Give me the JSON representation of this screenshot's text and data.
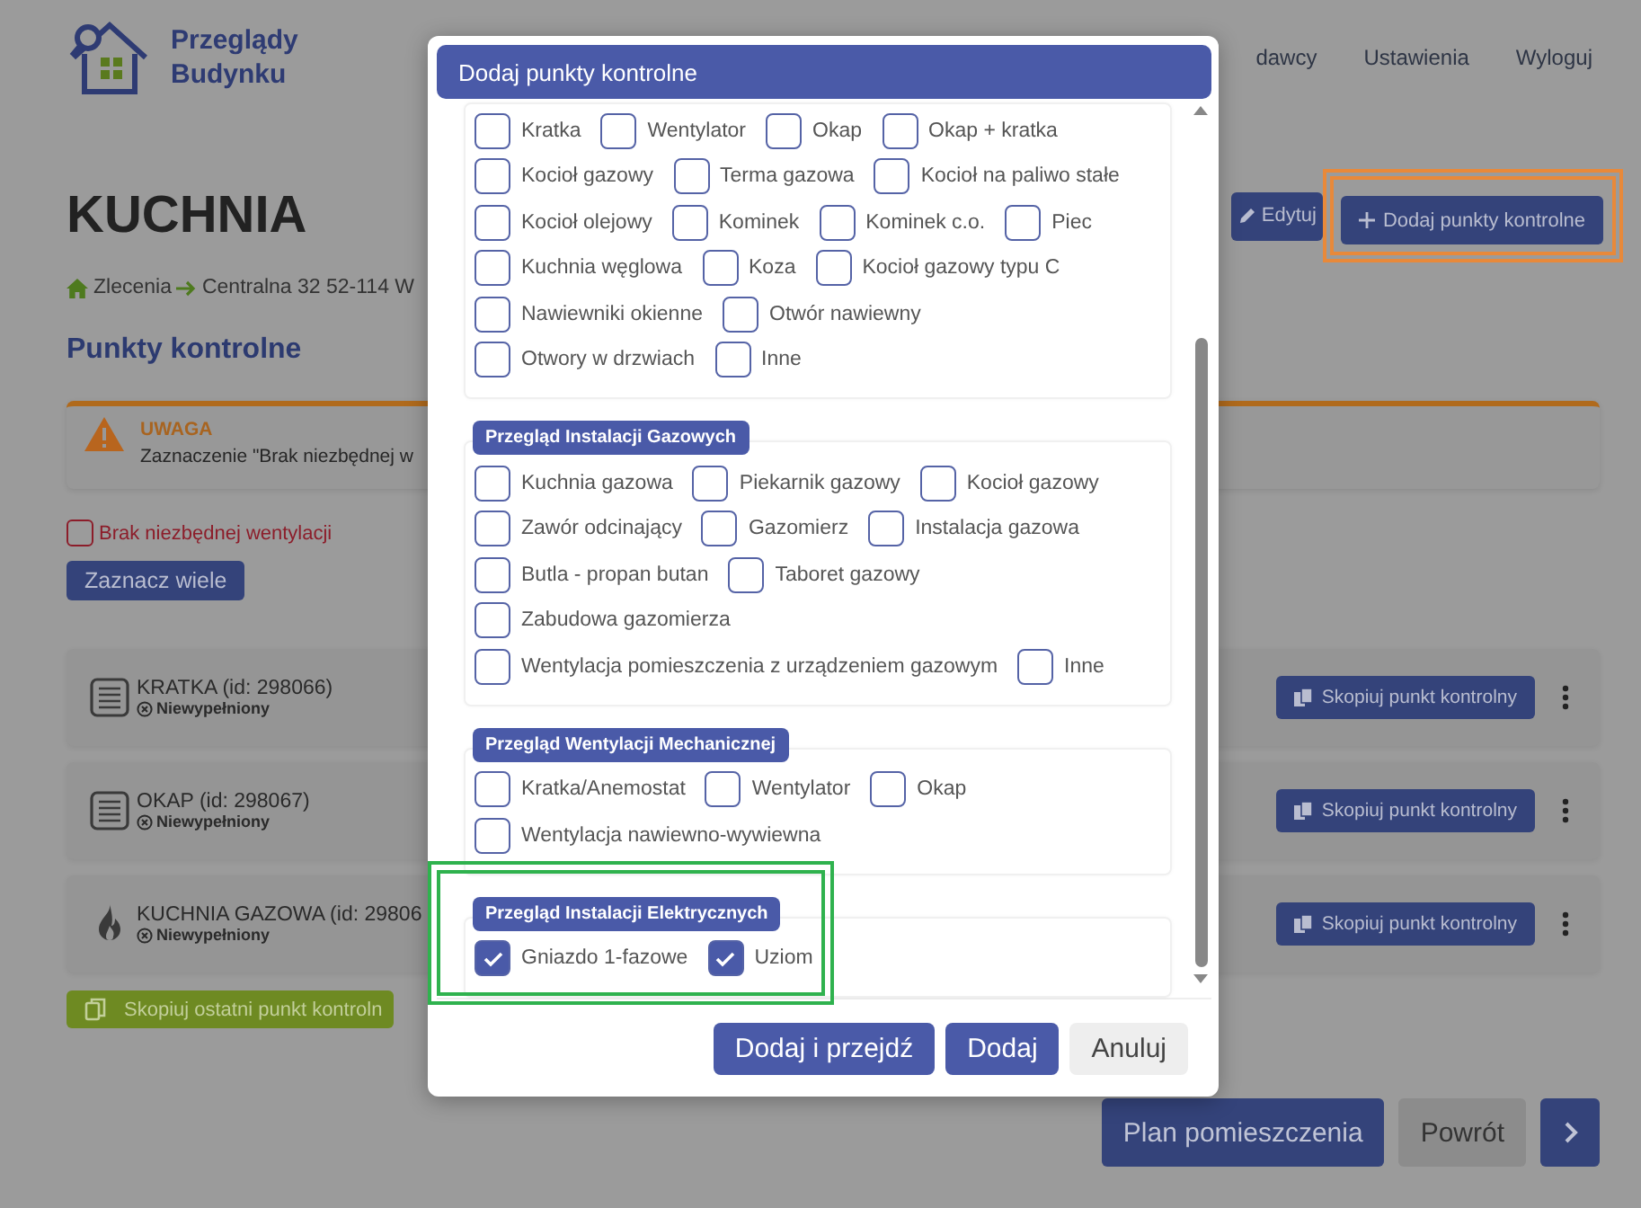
{
  "header": {
    "logo": [
      "Przeglądy",
      "Budynku"
    ],
    "nav": [
      "dawcy",
      "Ustawienia",
      "Wyloguj"
    ]
  },
  "page": {
    "title": "KUCHNIA",
    "actions": [
      {
        "label": "Edytuj",
        "kind": "edit",
        "highlighted": false
      },
      {
        "label": "Dodaj punkty kontrolne",
        "kind": "add",
        "highlighted": true
      }
    ],
    "breadcrumb": [
      "Zlecenia",
      "Centralna 32 52-114 W"
    ],
    "section_title": "Punkty kontrolne",
    "warning": {
      "title": "UWAGA",
      "text": "Zaznaczenie \"Brak niezbędnej w"
    },
    "ventilation_checkbox": {
      "label": "Brak niezbędnej wentylacji",
      "checked": false
    },
    "select_many_button": "Zaznacz wiele",
    "points": [
      {
        "kind": "document",
        "name": "KRATKA (id: 298066)",
        "status": "Niewypełniony",
        "copy_button": "Skopiuj punkt kontrolny"
      },
      {
        "kind": "document",
        "name": "OKAP (id: 298067)",
        "status": "Niewypełniony",
        "copy_button": "Skopiuj punkt kontrolny"
      },
      {
        "kind": "flame",
        "name": "KUCHNIA GAZOWA (id: 29806",
        "status": "Niewypełniony",
        "copy_button": "Skopiuj punkt kontrolny"
      }
    ],
    "copy_last_button": "Skopiuj ostatni punkt kontroln",
    "footer_buttons": [
      {
        "label": "Plan pomieszczenia",
        "kind": "primary"
      },
      {
        "label": "Powrót",
        "kind": "secondary"
      }
    ]
  },
  "modal": {
    "title": "Dodaj punkty kontrolne",
    "sections": [
      {
        "highlighted": false,
        "rows": [
          [
            {
              "label": "Kratka",
              "checked": false
            },
            {
              "label": "Wentylator",
              "checked": false
            },
            {
              "label": "Okap",
              "checked": false
            },
            {
              "label": "Okap + kratka",
              "checked": false
            }
          ],
          [
            {
              "label": "Kocioł gazowy",
              "checked": false
            },
            {
              "label": "Terma gazowa",
              "checked": false
            },
            {
              "label": "Kocioł na paliwo stałe",
              "checked": false
            }
          ],
          [
            {
              "label": "Kocioł olejowy",
              "checked": false
            },
            {
              "label": "Kominek",
              "checked": false
            },
            {
              "label": "Kominek c.o.",
              "checked": false
            },
            {
              "label": "Piec",
              "checked": false
            }
          ],
          [
            {
              "label": "Kuchnia węglowa",
              "checked": false
            },
            {
              "label": "Koza",
              "checked": false
            },
            {
              "label": "Kocioł gazowy typu C",
              "checked": false
            }
          ],
          [
            {
              "label": "Nawiewniki okienne",
              "checked": false
            },
            {
              "label": "Otwór nawiewny",
              "checked": false
            }
          ],
          [
            {
              "label": "Otwory w drzwiach",
              "checked": false
            },
            {
              "label": "Inne",
              "checked": false
            }
          ]
        ]
      },
      {
        "title": "Przegląd Instalacji Gazowych",
        "highlighted": false,
        "rows": [
          [
            {
              "label": "Kuchnia gazowa",
              "checked": false
            },
            {
              "label": "Piekarnik gazowy",
              "checked": false
            },
            {
              "label": "Kocioł gazowy",
              "checked": false
            }
          ],
          [
            {
              "label": "Zawór odcinający",
              "checked": false
            },
            {
              "label": "Gazomierz",
              "checked": false
            },
            {
              "label": "Instalacja gazowa",
              "checked": false
            }
          ],
          [
            {
              "label": "Butla - propan butan",
              "checked": false
            },
            {
              "label": "Taboret gazowy",
              "checked": false
            }
          ],
          [
            {
              "label": "Zabudowa gazomierza",
              "checked": false
            }
          ],
          [
            {
              "label": "Wentylacja pomieszczenia z urządzeniem gazowym",
              "checked": false
            },
            {
              "label": "Inne",
              "checked": false
            }
          ]
        ]
      },
      {
        "title": "Przegląd Wentylacji Mechanicznej",
        "highlighted": false,
        "rows": [
          [
            {
              "label": "Kratka/Anemostat",
              "checked": false
            },
            {
              "label": "Wentylator",
              "checked": false
            },
            {
              "label": "Okap",
              "checked": false
            }
          ],
          [
            {
              "label": "Wentylacja nawiewno-wywiewna",
              "checked": false
            }
          ]
        ]
      },
      {
        "title": "Przegląd Instalacji Elektrycznych",
        "highlighted": true,
        "rows": [
          [
            {
              "label": "Gniazdo 1-fazowe",
              "checked": true
            },
            {
              "label": "Uziom",
              "checked": true
            }
          ]
        ]
      }
    ],
    "buttons": [
      {
        "label": "Dodaj i przejdź",
        "kind": "primary"
      },
      {
        "label": "Dodaj",
        "kind": "primary"
      },
      {
        "label": "Anuluj",
        "kind": "secondary"
      }
    ]
  }
}
